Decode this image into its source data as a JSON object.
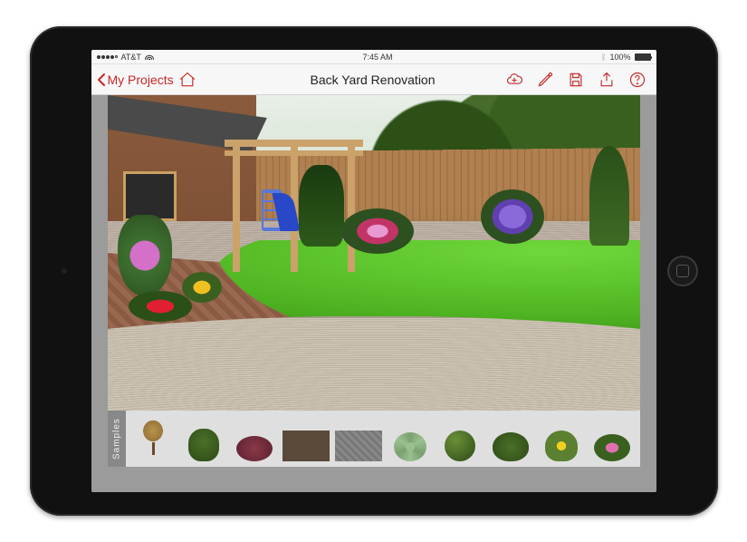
{
  "status_bar": {
    "carrier": "AT&T",
    "time": "7:45 AM",
    "battery_pct": "100%"
  },
  "navbar": {
    "back_label": "My Projects",
    "title": "Back Yard Renovation"
  },
  "samples": {
    "label": "Samples",
    "items": [
      {
        "name": "small-deciduous-tree"
      },
      {
        "name": "conical-shrub-green"
      },
      {
        "name": "round-shrub-burgundy"
      },
      {
        "name": "texture-mulch-brown"
      },
      {
        "name": "texture-paver-grey"
      },
      {
        "name": "succulent-rosette"
      },
      {
        "name": "boxwood-ball"
      },
      {
        "name": "round-shrub-green"
      },
      {
        "name": "flowering-shrub-yellow"
      },
      {
        "name": "flowering-shrub-pink"
      }
    ]
  },
  "colors": {
    "accent": "#c62828"
  }
}
